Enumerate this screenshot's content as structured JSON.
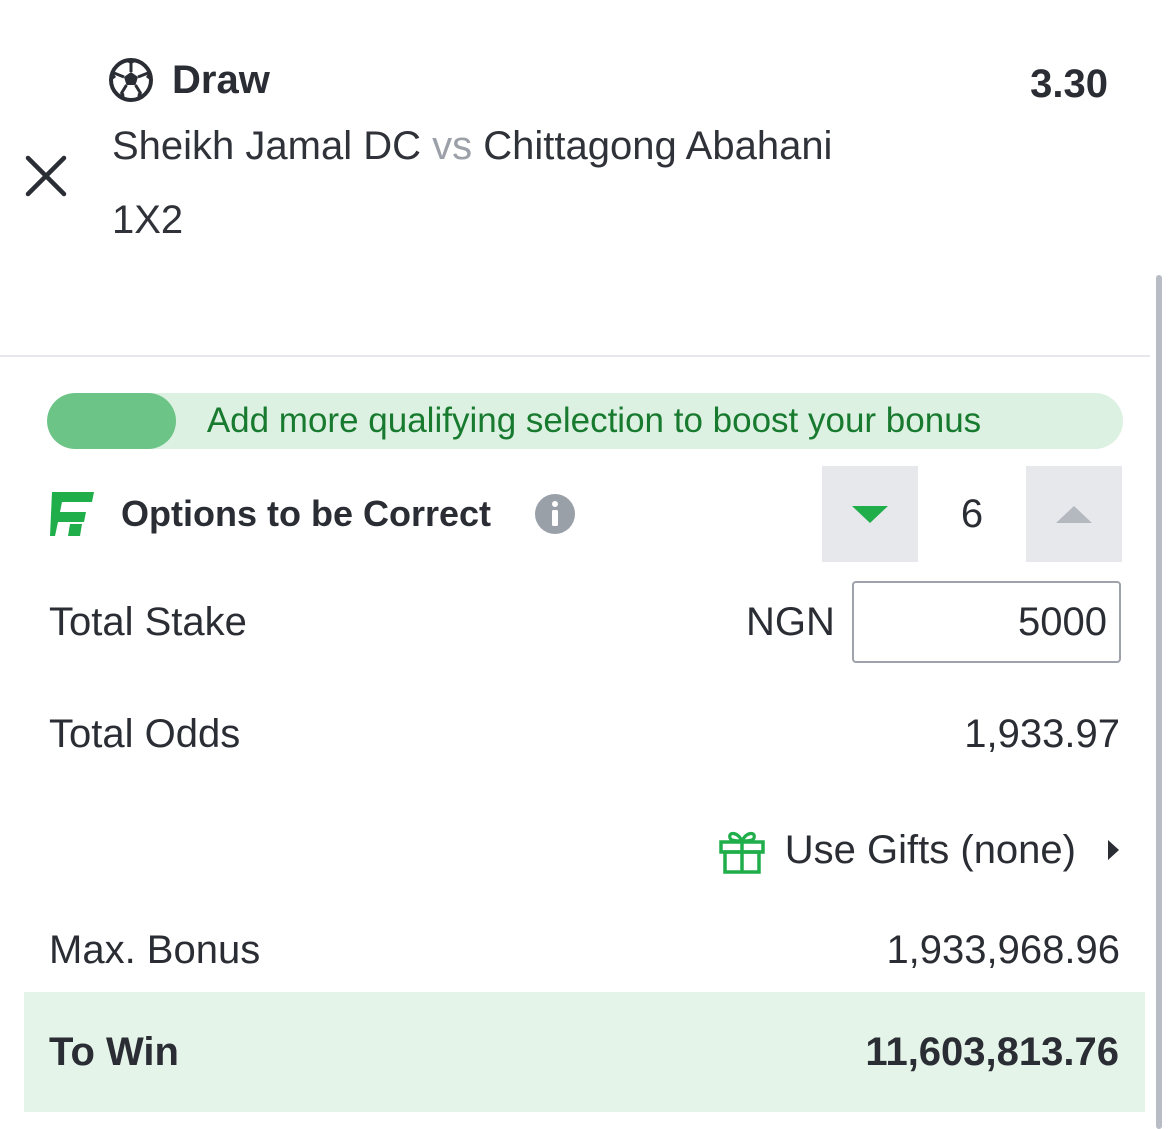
{
  "selection": {
    "title": "Draw",
    "odds": "3.30",
    "home_team": "Sheikh Jamal DC",
    "vs": "vs",
    "away_team": "Chittagong Abahani",
    "market": "1X2"
  },
  "bonus_progress": {
    "message": "Add more qualifying selection to boost your bonus",
    "fill_fraction": 0.12
  },
  "options": {
    "label": "Options to be Correct",
    "value": "6"
  },
  "stake": {
    "label": "Total Stake",
    "currency": "NGN",
    "value": "5000"
  },
  "odds": {
    "label": "Total Odds",
    "value": "1,933.97"
  },
  "gifts": {
    "label": "Use Gifts (none)"
  },
  "bonus": {
    "label": "Max. Bonus",
    "value": "1,933,968.96"
  },
  "to_win": {
    "label": "To Win",
    "value": "11,603,813.76"
  },
  "icons": {
    "close": "close-icon",
    "ball": "soccer-ball-icon",
    "flex": "flex-logo-icon",
    "info": "info-icon",
    "down": "triangle-down-icon",
    "up": "triangle-up-icon",
    "gift": "gift-icon",
    "chevron": "chevron-right-icon"
  },
  "colors": {
    "accent_green": "#1fae4a",
    "progress_fill": "#6cc487",
    "progress_track": "#dcf1e2",
    "progress_text": "#187a2f",
    "to_win_background": "#e5f4e9",
    "stepper_background": "#e6e8ec"
  }
}
